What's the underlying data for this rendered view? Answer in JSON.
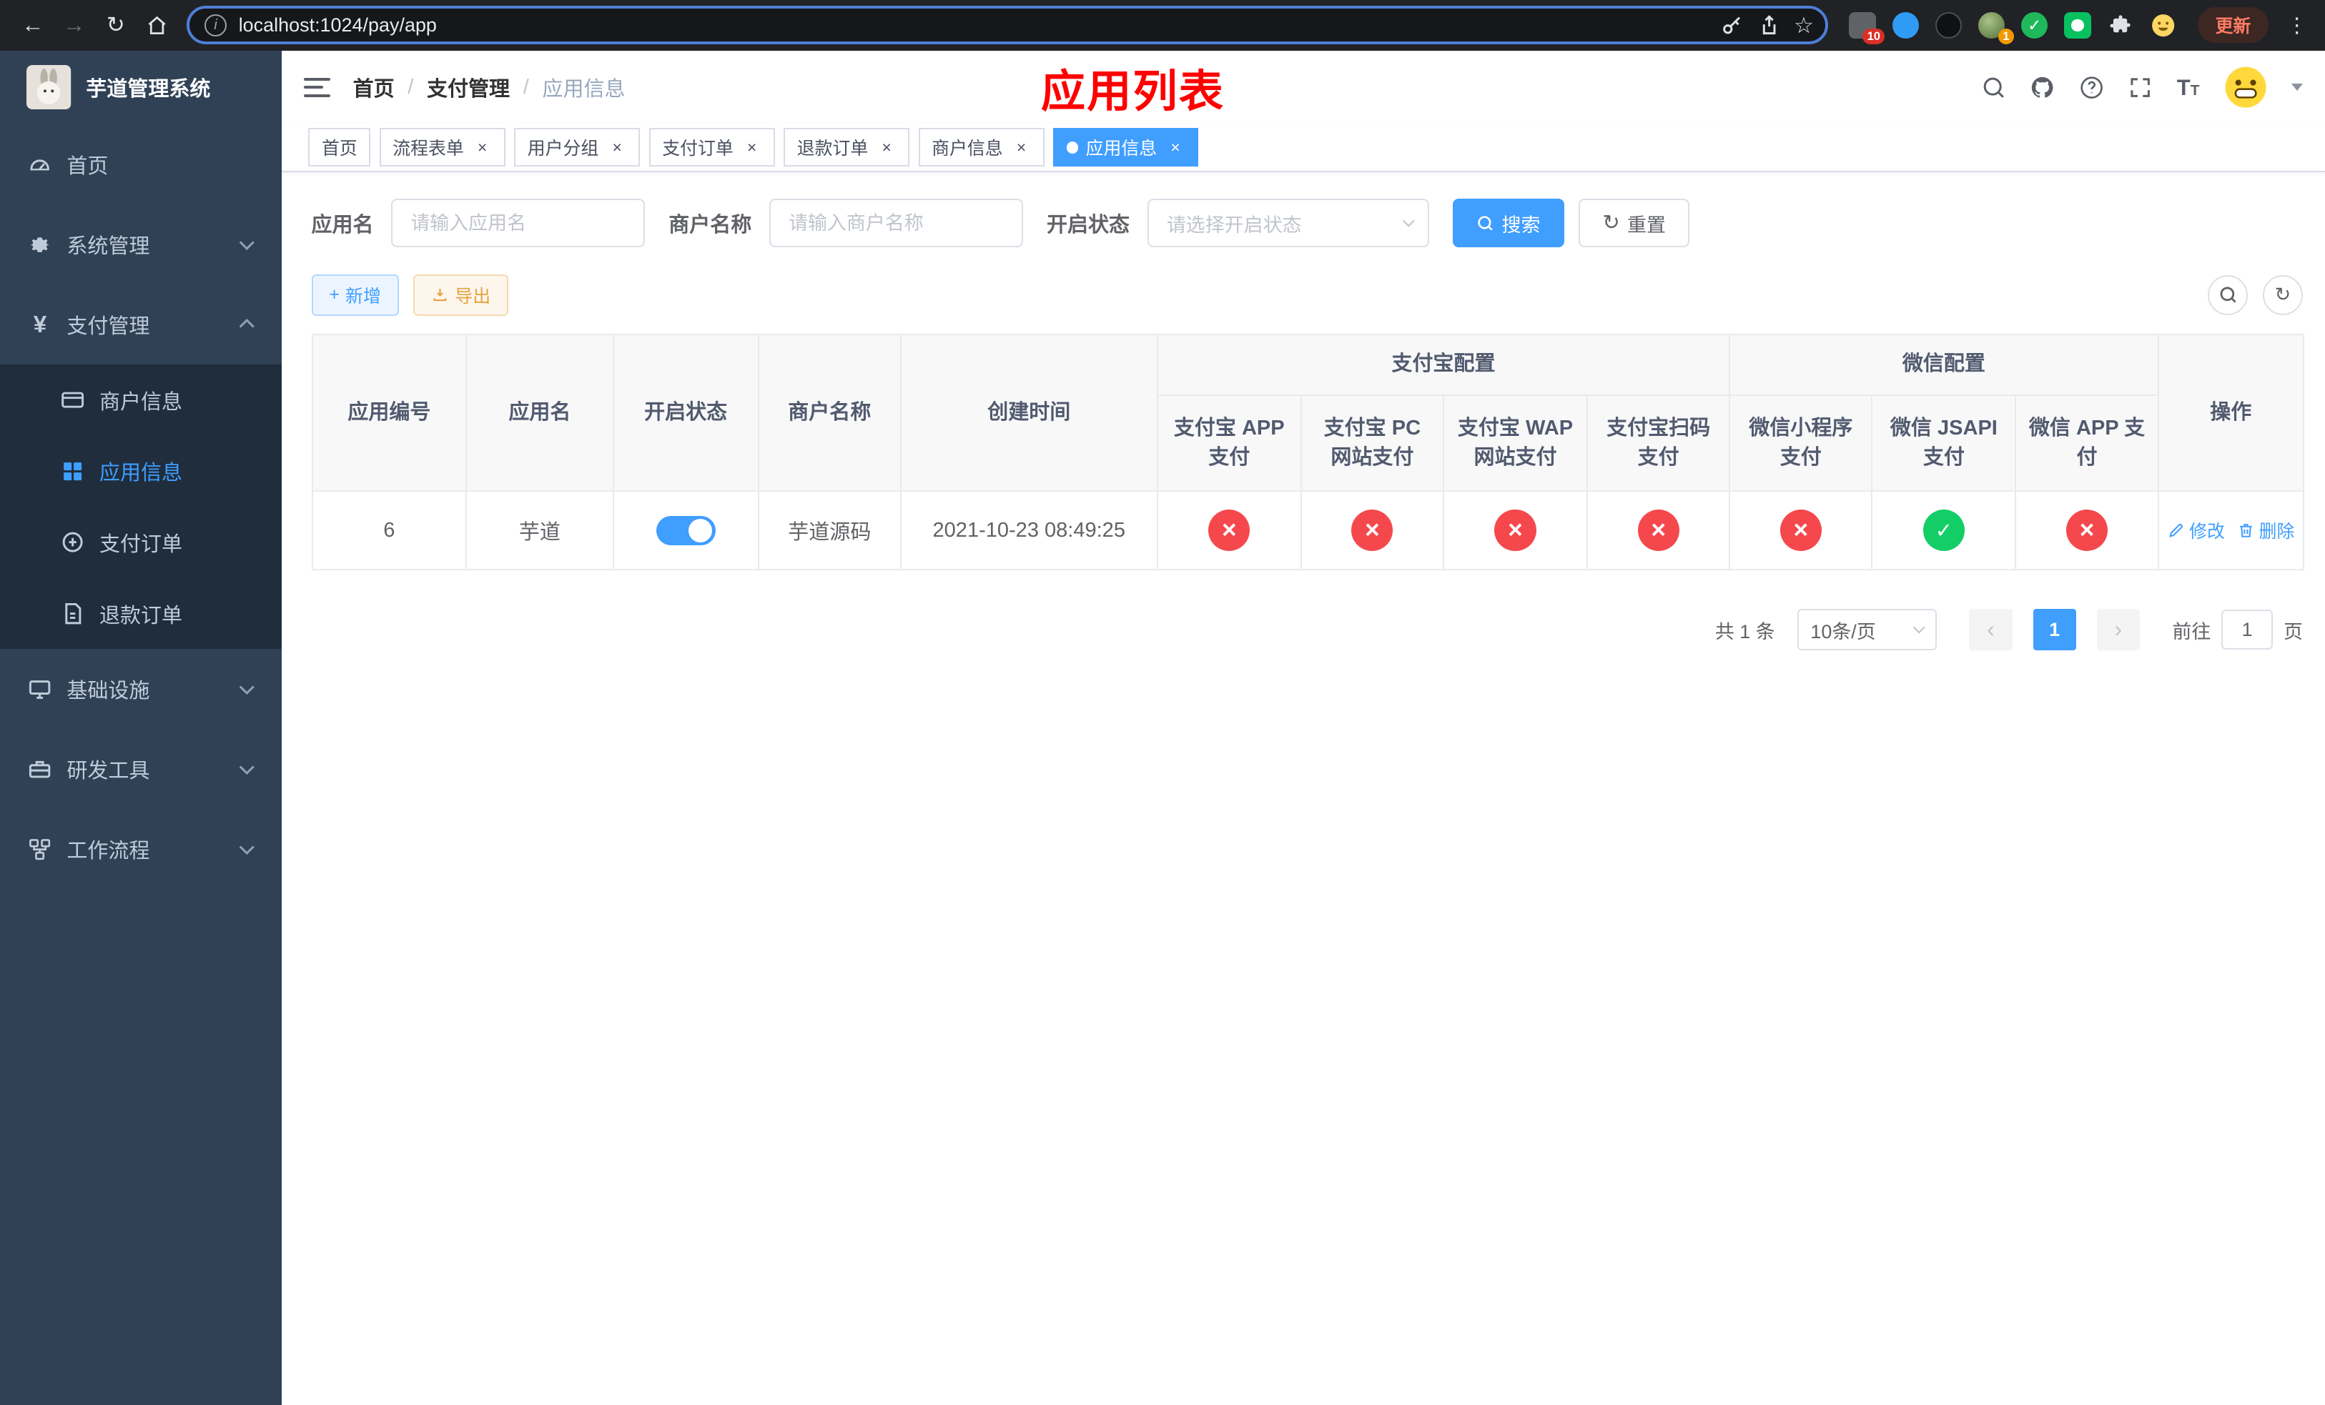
{
  "colors": {
    "accent": "#409eff",
    "success": "#13ce66",
    "danger": "#f5484d",
    "annotation": "#ff0000",
    "sidebar_bg": "#304156",
    "submenu_bg": "#1f2d3d"
  },
  "icons": {
    "back": "←",
    "forward": "→",
    "reload": "↻",
    "info": "i",
    "star": "☆",
    "kebab": "⋮",
    "check": "✓",
    "cross": "×",
    "plus": "+",
    "reset": "↻",
    "prev": "‹",
    "next": "›",
    "text_t_big": "T",
    "text_t_small": "T"
  },
  "browser": {
    "url": "localhost:1024/pay/app",
    "update_label": "更新",
    "extensions_badge": "10",
    "avatar_badge": "1"
  },
  "sidebar": {
    "title": "芋道管理系统",
    "items": [
      {
        "label": "首页"
      },
      {
        "label": "系统管理"
      },
      {
        "label": "支付管理"
      },
      {
        "label": "基础设施"
      },
      {
        "label": "研发工具"
      },
      {
        "label": "工作流程"
      }
    ],
    "submenu": [
      {
        "label": "商户信息"
      },
      {
        "label": "应用信息"
      },
      {
        "label": "支付订单"
      },
      {
        "label": "退款订单"
      }
    ]
  },
  "header": {
    "breadcrumb": [
      "首页",
      "支付管理",
      "应用信息"
    ],
    "annotation": "应用列表"
  },
  "tabs": [
    {
      "label": "首页"
    },
    {
      "label": "流程表单"
    },
    {
      "label": "用户分组"
    },
    {
      "label": "支付订单"
    },
    {
      "label": "退款订单"
    },
    {
      "label": "商户信息"
    },
    {
      "label": "应用信息"
    }
  ],
  "filters": {
    "app_name": {
      "label": "应用名",
      "placeholder": "请输入应用名"
    },
    "merchant_name": {
      "label": "商户名称",
      "placeholder": "请输入商户名称"
    },
    "status": {
      "label": "开启状态",
      "placeholder": "请选择开启状态"
    },
    "search": "搜索",
    "reset": "重置"
  },
  "toolbar": {
    "add": "新增",
    "export": "导出"
  },
  "table": {
    "groups": {
      "alipay": "支付宝配置",
      "wechat": "微信配置"
    },
    "columns": [
      "应用编号",
      "应用名",
      "开启状态",
      "商户名称",
      "创建时间",
      "支付宝 APP 支付",
      "支付宝 PC 网站支付",
      "支付宝 WAP 网站支付",
      "支付宝扫码支付",
      "微信小程序支付",
      "微信 JSAPI 支付",
      "微信 APP 支付",
      "操作"
    ],
    "rows": [
      {
        "id": "6",
        "name": "芋道",
        "enabled": true,
        "merchant": "芋道源码",
        "created": "2021-10-23 08:49:25",
        "configs": [
          false,
          false,
          false,
          false,
          false,
          true,
          false
        ],
        "edit": "修改",
        "delete": "删除"
      }
    ]
  },
  "pagination": {
    "total": "共 1 条",
    "page_size": "10条/页",
    "page": "1",
    "goto": "前往",
    "goto_value": "1",
    "unit": "页"
  }
}
